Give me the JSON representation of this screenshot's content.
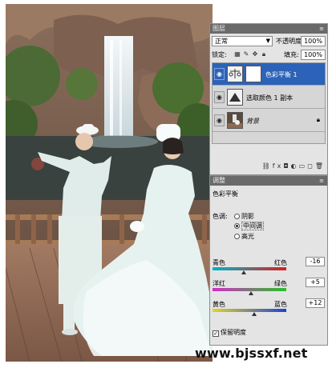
{
  "photo": {
    "subject": "wedding-couple-waterfall"
  },
  "layers_panel": {
    "title": "图层",
    "blend_mode": "正常",
    "opacity_label": "不透明度:",
    "opacity_value": "100%",
    "lock_label": "锁定:",
    "fill_label": "填充:",
    "fill_value": "100%",
    "layers": [
      {
        "name": "色彩平衡 1",
        "selected": true
      },
      {
        "name": "选取颜色 1 副本",
        "selected": false
      },
      {
        "name": "背景",
        "selected": false
      }
    ]
  },
  "adjustments_panel": {
    "title": "调整",
    "panel_title": "色彩平衡",
    "tone_label": "色调:",
    "tones": [
      "阴影",
      "中间调",
      "高光"
    ],
    "selected_tone": "中间调",
    "sliders": [
      {
        "left": "青色",
        "right": "红色",
        "value": "-16"
      },
      {
        "left": "洋红",
        "right": "绿色",
        "value": "+5"
      },
      {
        "left": "黄色",
        "right": "蓝色",
        "value": "+12"
      }
    ],
    "preserve_label": "保留明度",
    "preserve_checked": true
  },
  "watermark": "www.bjssxf.net",
  "colors": {
    "panel_bg": "#e4e4e4",
    "titlebar": "#6a6a6a",
    "selected_layer": "#2c63b8"
  }
}
